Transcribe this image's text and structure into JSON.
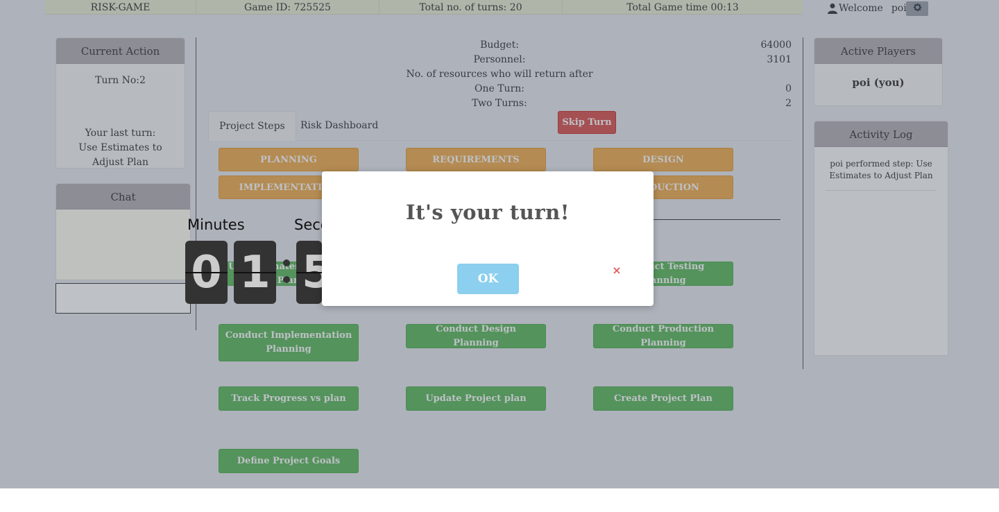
{
  "header": {
    "app_name": "RISK-GAME",
    "game_id": "Game ID: 725525",
    "total_turns": "Total no. of turns: 20",
    "total_time": "Total Game time 00:13",
    "welcome": "Welcome",
    "username": "poi!"
  },
  "current_action": {
    "title": "Current Action",
    "turn_no": "Turn No:2",
    "last_turn_label": "Your last turn:",
    "last_turn_value": "Use Estimates to Adjust Plan"
  },
  "chat": {
    "title": "Chat"
  },
  "stats": {
    "budget_label": "Budget:",
    "budget_value": "64000",
    "personnel_label": "Personnel:",
    "personnel_value": "3101",
    "resources_label": "No. of resources who will return after",
    "one_turn_label": "One Turn:",
    "one_turn_value": "0",
    "two_turns_label": "Two Turns:",
    "two_turns_value": "2"
  },
  "tabs": [
    {
      "label": "Project Steps"
    },
    {
      "label": "Risk Dashboard"
    }
  ],
  "skip_turn": "Skip Turn",
  "phases": [
    "PLANNING",
    "REQUIREMENTS",
    "DESIGN",
    "IMPLEMENTATION",
    "PRODUCTION"
  ],
  "steps": {
    "use_estimates": "Use Estimates to Adjust Plan",
    "testing_planning": "Conduct Testing Planning",
    "implementation_planning": "Conduct Implementation Planning",
    "design_planning": "Conduct Design Planning",
    "production_planning": "Conduct Production Planning",
    "track_progress": "Track Progress vs plan",
    "update_plan": "Update Project plan",
    "create_plan": "Create Project Plan",
    "define_goals": "Define Project Goals"
  },
  "active_players": {
    "title": "Active Players",
    "player": "poi (you)"
  },
  "activity_log": {
    "title": "Activity Log",
    "entries": [
      "poi performed step: Use Estimates to Adjust Plan"
    ]
  },
  "timer": {
    "minutes_label": "Minutes",
    "seconds_label": "Seconds",
    "digits": [
      "0",
      "1",
      "5"
    ]
  },
  "modal": {
    "title": "It's your turn!",
    "ok": "OK",
    "close": "×"
  },
  "colors": {
    "phase": "#f0ad4e",
    "step": "#5cb85c",
    "skip": "#d9534f",
    "ok": "#8ccfee",
    "topbar": "#e9edd3"
  }
}
